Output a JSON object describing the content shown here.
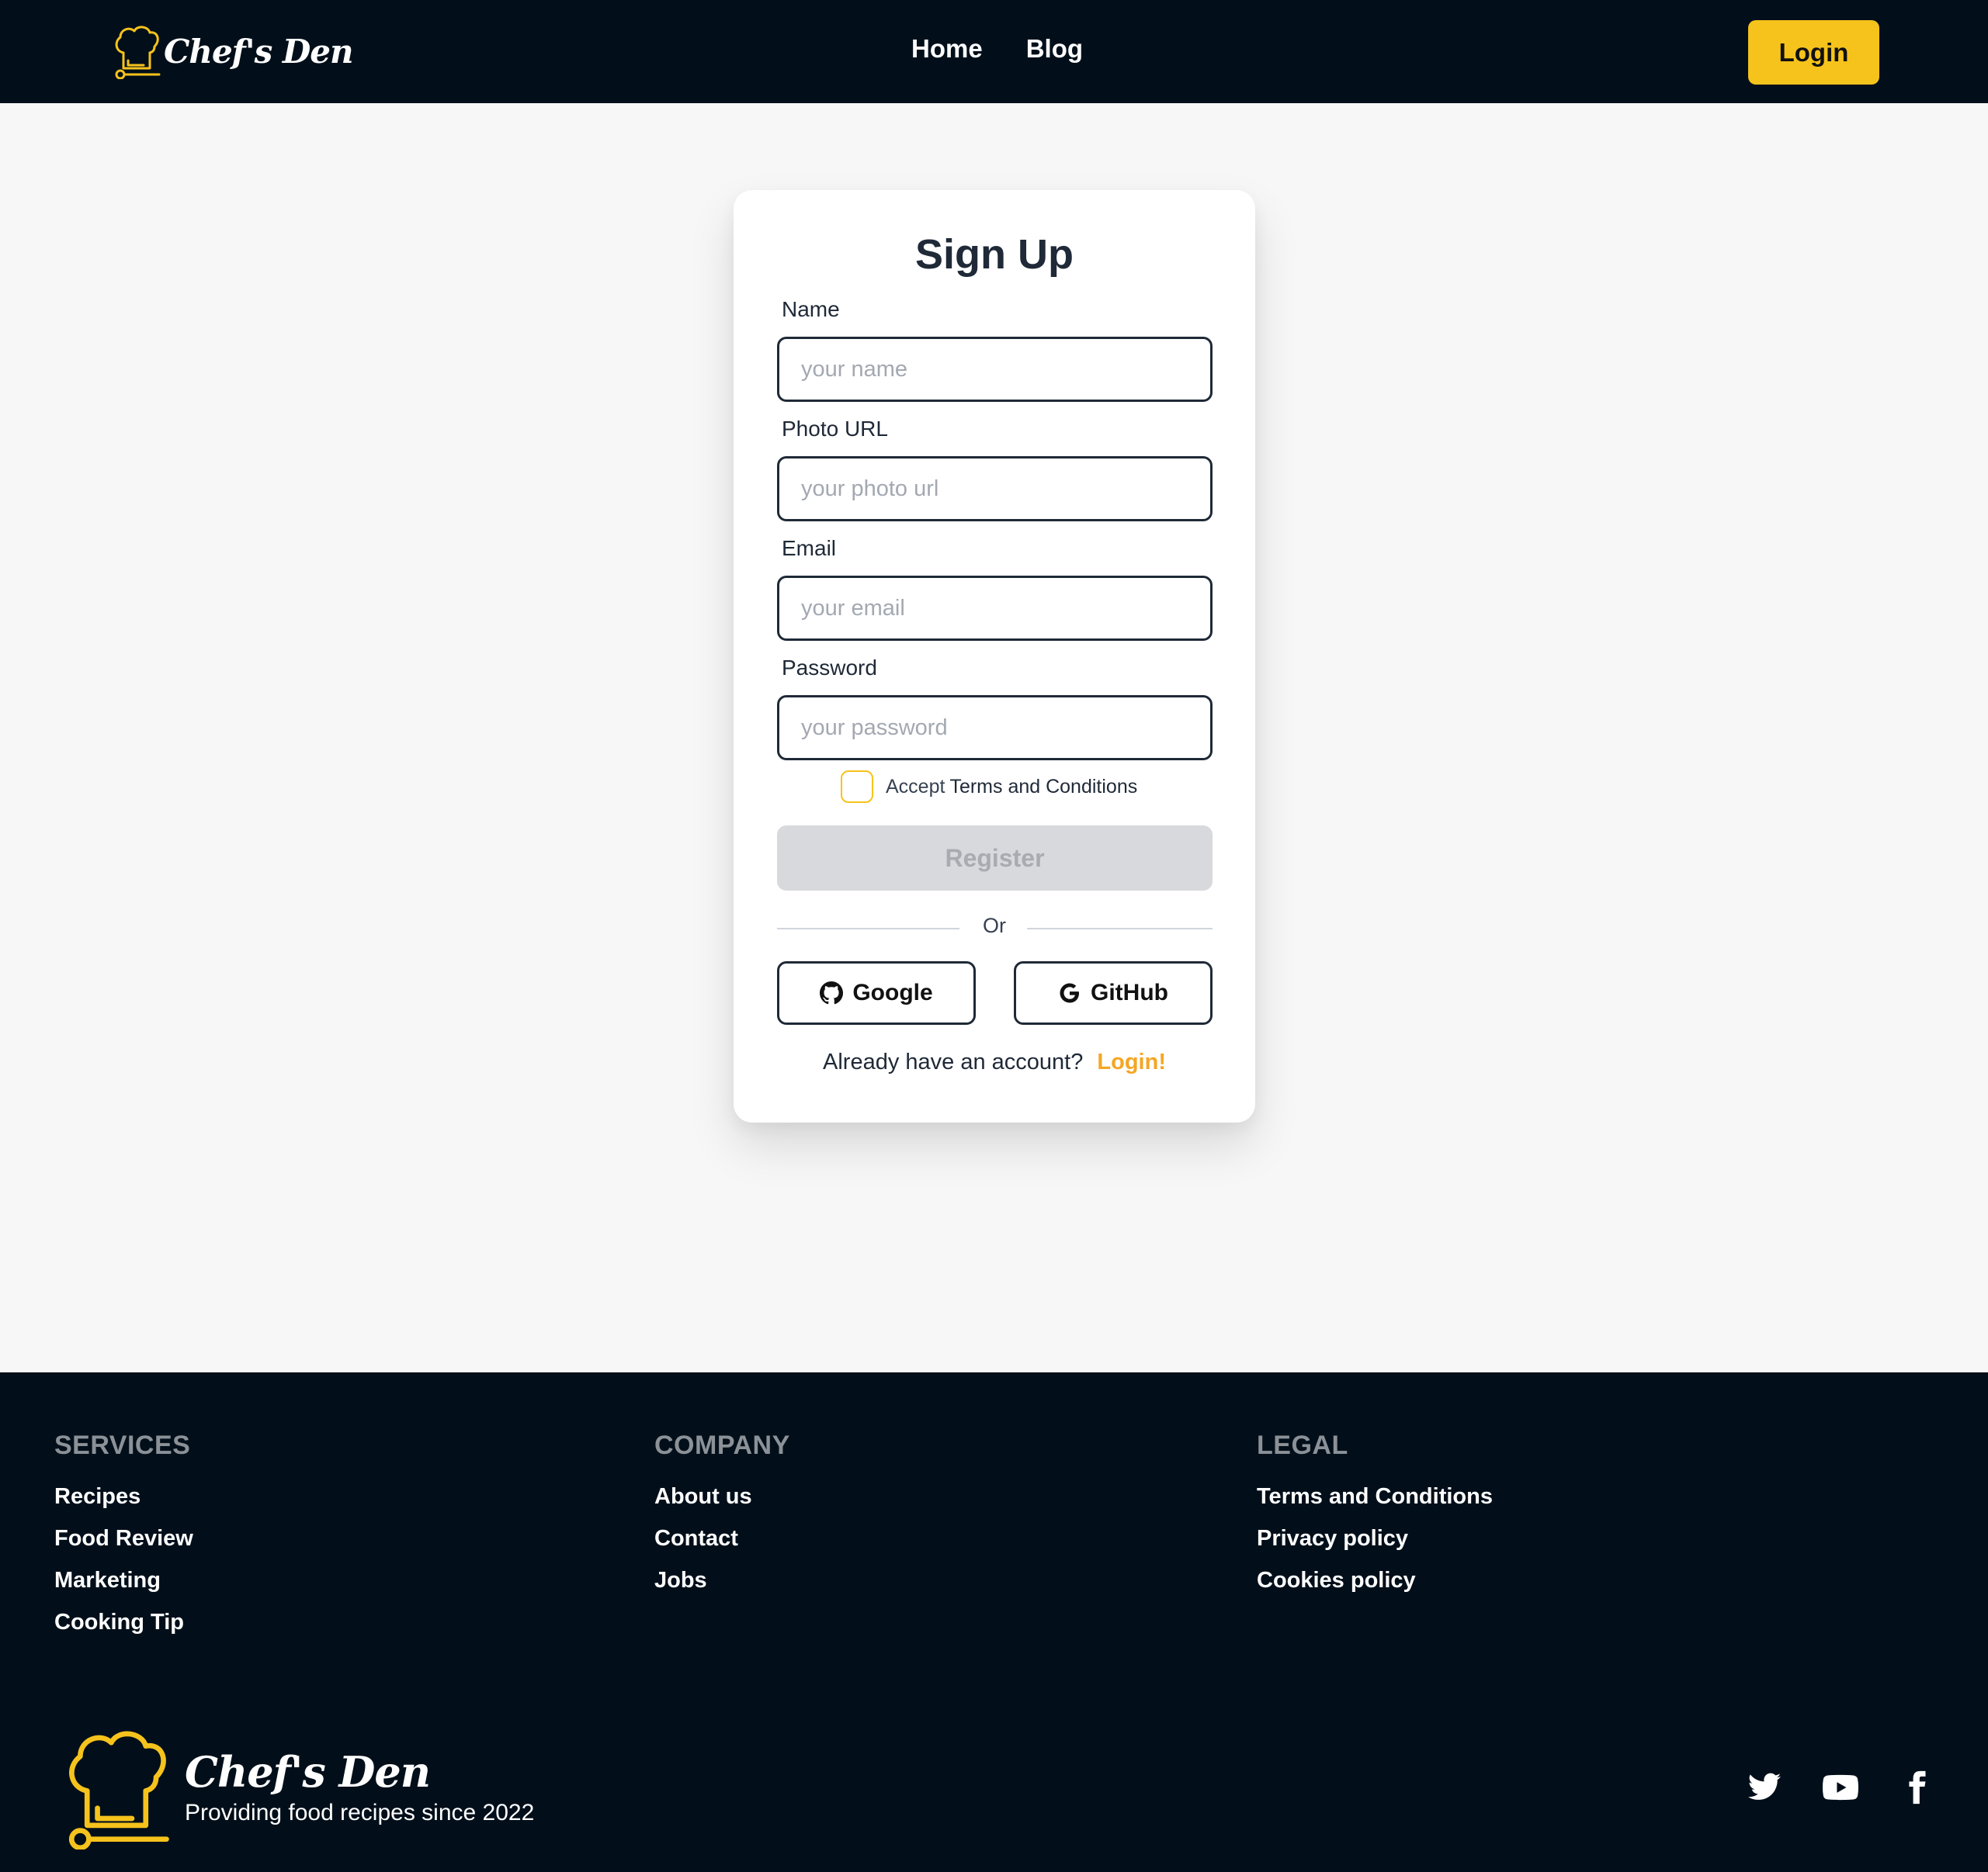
{
  "navbar": {
    "brand": "Chef's Den",
    "links": [
      "Home",
      "Blog"
    ],
    "login_label": "Login"
  },
  "signup": {
    "title": "Sign Up",
    "fields": [
      {
        "label": "Name",
        "placeholder": "your name",
        "value": ""
      },
      {
        "label": "Photo URL",
        "placeholder": "your photo url",
        "value": ""
      },
      {
        "label": "Email",
        "placeholder": "your email",
        "value": ""
      },
      {
        "label": "Password",
        "placeholder": "your password",
        "value": ""
      }
    ],
    "terms_prefix": "Accept",
    "terms_link": "Terms and Conditions",
    "terms_checked": false,
    "register_label": "Register",
    "divider": "Or",
    "google_label": "Google",
    "github_label": "GitHub",
    "account_text": "Already have an account?",
    "login_link": "Login!"
  },
  "footer": {
    "columns": [
      {
        "heading": "SERVICES",
        "links": [
          "Recipes",
          "Food Review",
          "Marketing",
          "Cooking Tip"
        ]
      },
      {
        "heading": "COMPANY",
        "links": [
          "About us",
          "Contact",
          "Jobs"
        ]
      },
      {
        "heading": "LEGAL",
        "links": [
          "Terms and Conditions",
          "Privacy policy",
          "Cookies policy"
        ]
      }
    ],
    "brand": "Chef's Den",
    "tagline": "Providing food recipes since 2022",
    "social": [
      "twitter-icon",
      "youtube-icon",
      "facebook-icon"
    ]
  },
  "colors": {
    "dark": "#020f1a",
    "accent": "#f6c31c",
    "link_orange": "#f5a623"
  }
}
